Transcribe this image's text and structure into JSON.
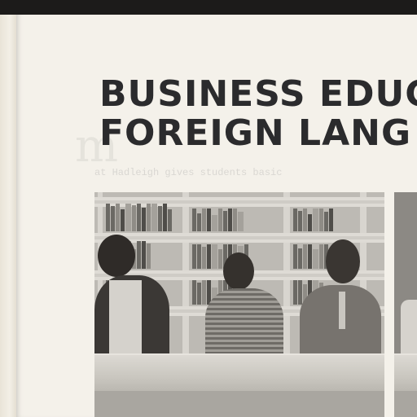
{
  "page": {
    "title_lines": [
      "BUSINESS EDUC",
      "FOREIGN LANG"
    ],
    "bleed_through": "at Hadleigh gives students basic",
    "photo": {
      "subject_icons": [
        "bookshelf-icon",
        "person-icon"
      ]
    }
  },
  "colors": {
    "page": "#f4f1ea",
    "title": "#2b2b2d",
    "scanner_bed": "#1c1b1a"
  }
}
